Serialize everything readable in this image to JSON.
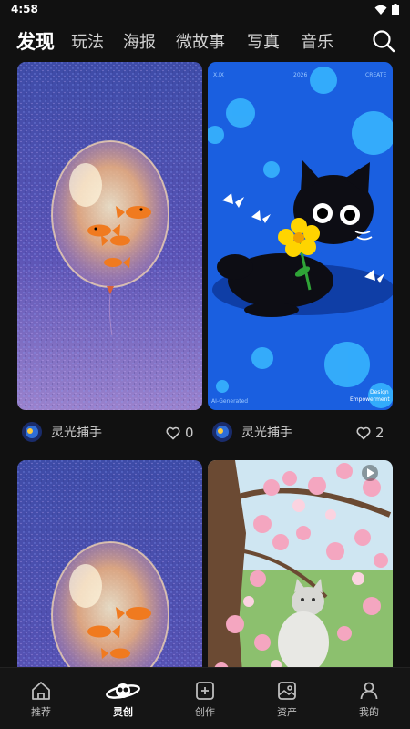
{
  "status": {
    "time": "4:58"
  },
  "top_tabs": [
    {
      "label": "发现"
    },
    {
      "label": "玩法"
    },
    {
      "label": "海报"
    },
    {
      "label": "微故事"
    },
    {
      "label": "写真"
    },
    {
      "label": "音乐"
    }
  ],
  "active_tab": "发现",
  "feed": {
    "cards": [
      {
        "author": "灵光捕手",
        "likes": "0",
        "image": "goldfish-balloon"
      },
      {
        "author": "灵光捕手",
        "likes": "2",
        "image": "black-cat-with-flower",
        "texts": {
          "top_left": "X.IX",
          "top_mid": "2026",
          "top_right": "CREATE",
          "bottom_left": "AI-Generated",
          "bottom_right_1": "Design",
          "bottom_right_2": "Empowerment"
        }
      },
      {
        "image": "goldfish-balloon"
      },
      {
        "image": "cherry-blossom-cat"
      }
    ]
  },
  "bottom_nav": [
    {
      "label": "推荐",
      "icon": "home-icon"
    },
    {
      "label": "灵创",
      "icon": "planet-icon"
    },
    {
      "label": "创作",
      "icon": "add-square-icon"
    },
    {
      "label": "资产",
      "icon": "gallery-icon"
    },
    {
      "label": "我的",
      "icon": "person-icon"
    }
  ],
  "active_nav": "灵创",
  "colors": {
    "background": "#111111",
    "nav_background": "#151515",
    "cat_bg": "#1a5fe0",
    "flower": "#ffd400"
  }
}
